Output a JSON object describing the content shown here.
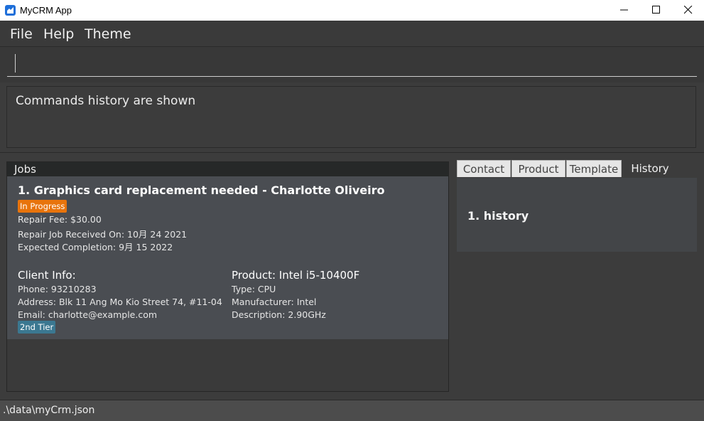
{
  "window": {
    "title": "MyCRM App",
    "controls": [
      "minimize",
      "maximize",
      "close"
    ]
  },
  "menu": {
    "items": [
      "File",
      "Help",
      "Theme"
    ]
  },
  "command_box": {
    "value": "",
    "placeholder": ""
  },
  "result_display": {
    "text": "Commands history are shown"
  },
  "jobs_panel": {
    "header": "Jobs",
    "job": {
      "title": "1. Graphics card replacement needed - Charlotte Oliveiro",
      "status": "In Progress",
      "status_color": "#e8740c",
      "fee": "Repair Fee: $30.00",
      "received": "Repair Job Received On: 10月 24 2021",
      "expected": "Expected Completion: 9月 15 2022",
      "client": {
        "heading": "Client Info:",
        "phone": "Phone: 93210283",
        "address": "Address: Blk 11 Ang Mo Kio Street 74, #11-04",
        "email": "Email: charlotte@example.com",
        "tier": "2nd Tier",
        "tier_color": "#3b7891"
      },
      "product": {
        "heading": "Product: Intel i5-10400F",
        "type": "Type: CPU",
        "manufacturer": "Manufacturer: Intel",
        "description": "Description: 2.90GHz"
      }
    }
  },
  "side_panel": {
    "tabs": [
      {
        "label": "Contact",
        "active": false
      },
      {
        "label": "Product",
        "active": false
      },
      {
        "label": "Template",
        "active": false
      },
      {
        "label": "History",
        "active": true
      }
    ],
    "history_entry": "1.  history"
  },
  "status_bar": {
    "path": ".\\data\\myCrm.json"
  }
}
